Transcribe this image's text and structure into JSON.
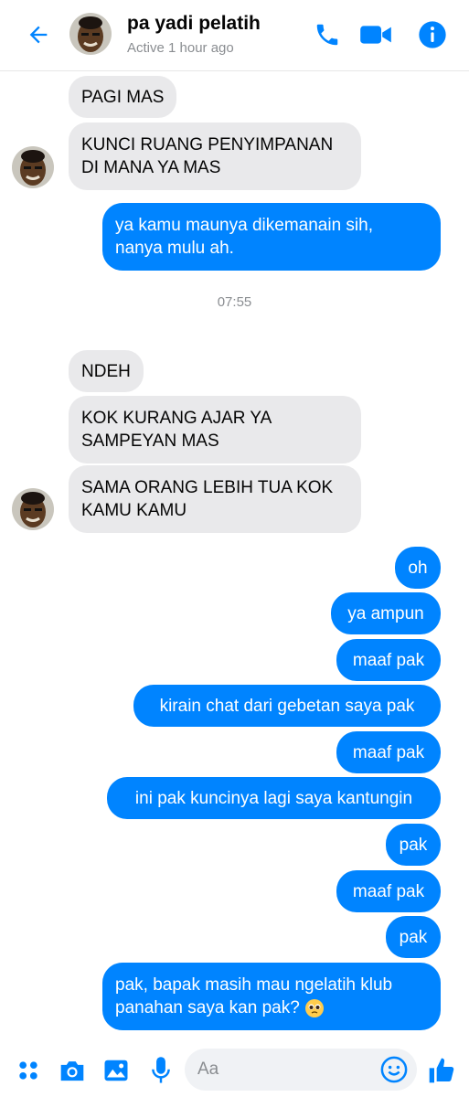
{
  "header": {
    "name": "pa yadi pelatih",
    "status": "Active 1 hour ago"
  },
  "messages": [
    {
      "text": "PAGI MAS"
    },
    {
      "text": "KUNCI RUANG PENYIMPANAN",
      "text2": "DI MANA YA MAS"
    },
    {
      "text": "ya kamu maunya dikemanain sih,",
      "text2": "nanya mulu ah."
    },
    {
      "text": "NDEH"
    },
    {
      "text": "KOK KURANG AJAR YA",
      "text2": "SAMPEYAN MAS"
    },
    {
      "text": "SAMA ORANG LEBIH TUA KOK",
      "text2": "KAMU KAMU"
    },
    {
      "text": "oh"
    },
    {
      "text": "ya ampun"
    },
    {
      "text": "maaf pak"
    },
    {
      "text": "kirain chat dari gebetan saya pak"
    },
    {
      "text": "maaf pak"
    },
    {
      "text": "ini pak kuncinya lagi saya kantungin"
    },
    {
      "text": "pak"
    },
    {
      "text": "maaf pak"
    },
    {
      "text": "pak"
    },
    {
      "text": "pak, bapak masih mau ngelatih klub",
      "text2": "panahan saya kan pak?"
    }
  ],
  "timestamp": "07:55",
  "composer": {
    "placeholder": "Aa"
  },
  "colors": {
    "accent": "#0084ff",
    "incoming_bubble": "#e9e9eb",
    "secondary_text": "#8a8d91"
  },
  "icons": [
    "back-arrow-icon",
    "phone-icon",
    "video-camera-icon",
    "info-icon",
    "apps-grid-icon",
    "camera-icon",
    "image-icon",
    "microphone-icon",
    "emoji-icon",
    "thumbs-up-icon",
    "pleading-face-emoji"
  ]
}
